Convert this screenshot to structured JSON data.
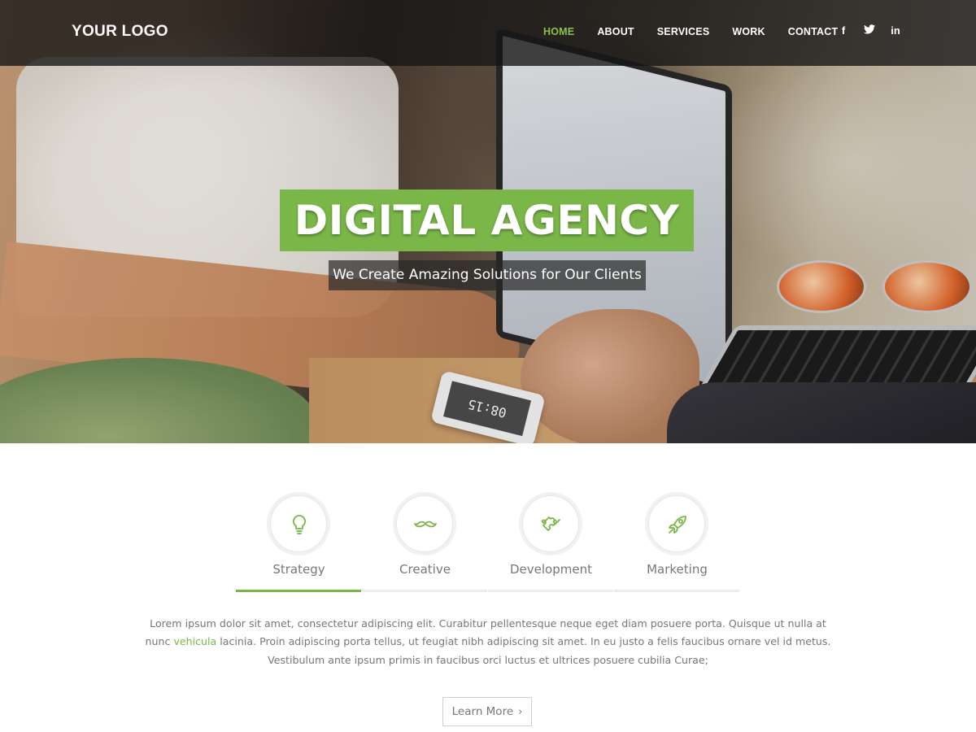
{
  "header": {
    "logo": "YOUR LOGO",
    "nav": [
      "HOME",
      "ABOUT",
      "SERVICES",
      "WORK",
      "CONTACT"
    ],
    "active_nav": "HOME",
    "social": [
      {
        "icon": "facebook-icon",
        "glyph": "f"
      },
      {
        "icon": "twitter-icon",
        "glyph": "t"
      },
      {
        "icon": "linkedin-icon",
        "glyph": "in"
      }
    ]
  },
  "hero": {
    "title": "DIGITAL AGENCY",
    "subtitle": "We Create Amazing Solutions for Our Clients",
    "phone_clock": "08:15"
  },
  "features": {
    "tabs": [
      {
        "label": "Strategy",
        "icon": "lightbulb-icon",
        "active": true
      },
      {
        "label": "Creative",
        "icon": "mustache-icon",
        "active": false
      },
      {
        "label": "Development",
        "icon": "puzzle-icon",
        "active": false
      },
      {
        "label": "Marketing",
        "icon": "rocket-icon",
        "active": false
      }
    ],
    "text_part1": "Lorem ipsum dolor sit amet, consectetur adipiscing elit. Curabitur pellentesque neque eget diam posuere porta. Quisque ut nulla at nunc",
    "text_link": "vehicula",
    "text_part2": "lacinia. Proin adipiscing porta tellus, ut feugiat nibh adipiscing sit amet. In eu justo a felis faucibus ornare vel id metus. Vestibulum ante ipsum primis in faucibus orci luctus et ultrices posuere cubilia Curae;",
    "button_label": "Learn More",
    "button_chevron": "›"
  },
  "colors": {
    "accent": "#7ab648",
    "nav_active": "#8dc04a",
    "navbar_bg": "#141414"
  }
}
